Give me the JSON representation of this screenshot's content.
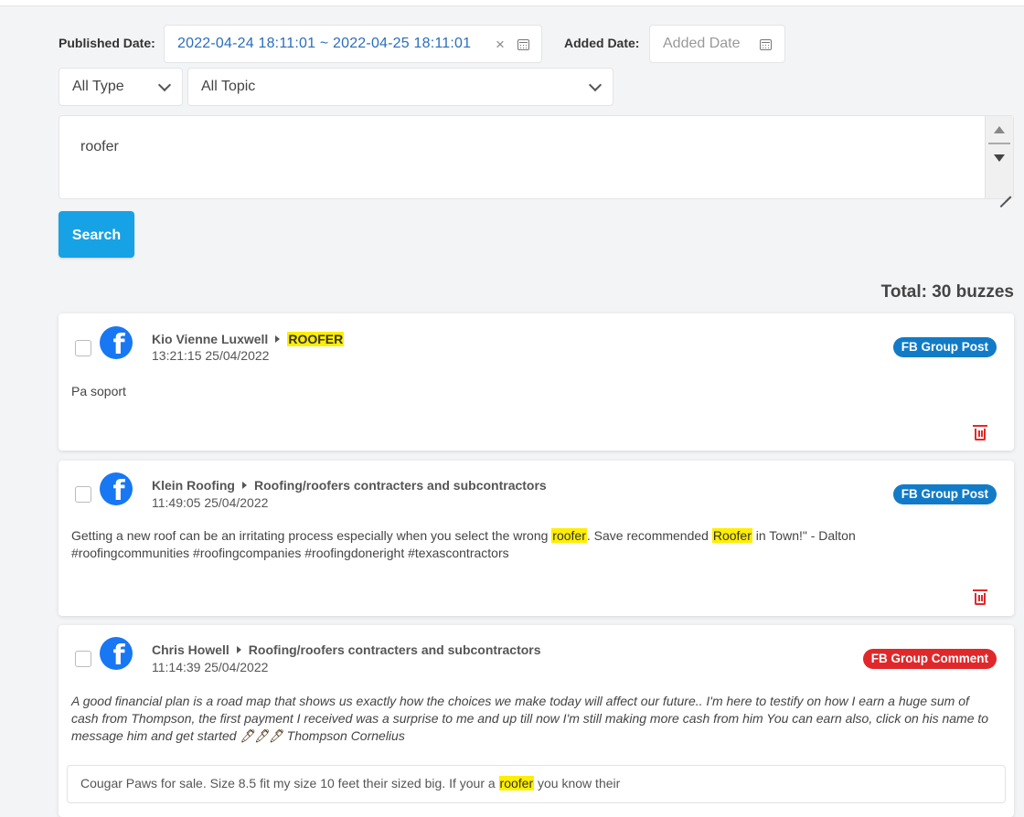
{
  "filters": {
    "published_label": "Published Date:",
    "published_value": "2022-04-24 18:11:01 ~ 2022-04-25 18:11:01",
    "clear_glyph": "×",
    "added_label": "Added Date:",
    "added_placeholder": "Added Date",
    "type_value": "All Type",
    "topic_value": "All Topic",
    "query_value": "roofer",
    "search_label": "Search"
  },
  "total": "Total: 30 buzzes",
  "posts": [
    {
      "author": "Kio Vienne Luxwell",
      "group": "ROOFER",
      "time": "13:21:15 25/04/2022",
      "badge": "FB Group Post",
      "text": "Pa soport"
    },
    {
      "author": "Klein Roofing",
      "group": "Roofing/roofers contracters and subcontractors",
      "time": "11:49:05 25/04/2022",
      "badge": "FB Group Post",
      "text_a": "Getting a new roof can be an irritating process especially when you select the wrong ",
      "hl1": "roofer",
      "text_b": ". Save recommended ",
      "hl2": "Roofer",
      "text_c": " in Town!\" - Dalton",
      "text_d": "#roofingcommunities #roofingcompanies #roofingdoneright #texascontractors"
    },
    {
      "author": "Chris Howell",
      "group": "Roofing/roofers contracters and subcontractors",
      "time": "11:14:39 25/04/2022",
      "badge": "FB Group Comment",
      "text_a": "A good financial plan is a road map that shows us exactly how the choices we make today will affect our future.. I'm here to testify on how I earn a huge sum of cash from Thompson, the first payment I received was a surprise to me and up till now I'm still making more cash from him You can earn also, click on his name to message him and get started ",
      "pens": "🖊🖊🖊",
      "text_b": " Thompson Cornelius",
      "parent_a": "Cougar Paws for sale. Size 8.5 fit my size 10 feet their sized big. If your a ",
      "parent_hl": "roofer",
      "parent_b": " you know their"
    }
  ],
  "colors": {
    "accent": "#17a2e6",
    "badge_post": "#127bc7",
    "badge_comment": "#e0282b",
    "highlight": "#ffee00",
    "facebook": "#1877f2"
  }
}
